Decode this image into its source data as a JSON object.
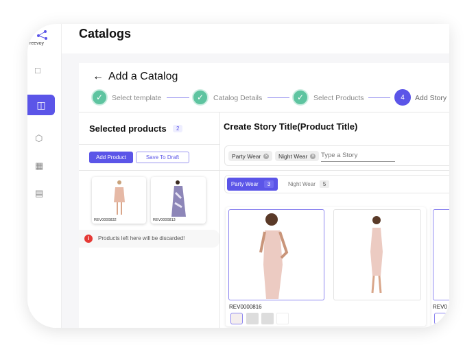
{
  "brand": {
    "name": "reevoy"
  },
  "header": {
    "title": "Catalogs"
  },
  "page": {
    "back_icon": "arrow-left-icon",
    "title": "Add a Catalog"
  },
  "stepper": [
    {
      "label": "Select template",
      "state": "done"
    },
    {
      "label": "Catalog Details",
      "state": "done"
    },
    {
      "label": "Select Products",
      "state": "done"
    },
    {
      "label": "Add Story",
      "state": "active",
      "number": "4"
    }
  ],
  "left": {
    "title": "Selected products",
    "count": "2",
    "add_product": "Add Product",
    "save_draft": "Save To Draft",
    "products": [
      {
        "id": "REV0000832"
      },
      {
        "id": "REV0000813"
      }
    ],
    "warning": "Products left here will be discarded!"
  },
  "right": {
    "title": "Create Story Title(Product Title)",
    "chips": [
      "Party Wear",
      "Night Wear"
    ],
    "input_placeholder": "Type a Story",
    "tabs": [
      {
        "label": "Party Wear",
        "count": "3",
        "active": true
      },
      {
        "label": "Night Wear",
        "count": "5",
        "active": false
      }
    ],
    "product": {
      "id": "REV0000816"
    },
    "next_product_id": "REV0"
  },
  "colors": {
    "accent": "#5b55e8",
    "success": "#5ec4a0",
    "danger": "#e53935"
  }
}
